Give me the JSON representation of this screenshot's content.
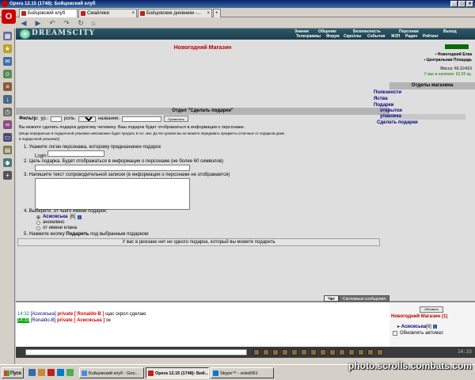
{
  "window": {
    "title": "Opera 12.15 (1748): Бойцовский клуб"
  },
  "browser_tabs": [
    {
      "label": "Бойцовский клуб"
    },
    {
      "label": "Смайлики"
    },
    {
      "label": "Бойцовские дневники -..."
    }
  ],
  "game_nav": {
    "logo_text": "DREAMSCITY",
    "row1": [
      "Знания",
      "Общение",
      "Безопасность",
      "Персонаж",
      "Выход"
    ],
    "row2": [
      "Телеграммы",
      "Форум",
      "Скрολлы",
      "События",
      "ЖЗП",
      "Радио",
      "Рейтинг"
    ]
  },
  "shop": {
    "title": "Новогодний Магазин",
    "section_title": "Отдел \"Сделать подарки\"",
    "filter": {
      "label": "Фильтр:",
      "level_label": "ур.:",
      "role_label": "роль:",
      "role_value": "любая",
      "name_label": "название:",
      "apply_label": "Применить"
    },
    "description": {
      "line1": "Вы можете сделать подарок дорогому человеку. Ваш подарок будет отображаться в информации о персонаже.",
      "line2": "(вещи переданные в подарочной упаковке невозможно будет продать в гос. маг. До 8го уровня вы не можете передавать предметы отличные от подарков даже",
      "line3": "в подарочной упаковке))"
    },
    "steps": {
      "s1": "1.  Укажите логин персонажа, которому предназначен подарок",
      "login_label": "Login",
      "s2": "2.  Цель подарка. Будет отображаться в информации о персонаже (не более 60 символов)",
      "s3": "3.  Напишите текст сопроводительной записки (в информации о персонаже не отображается)",
      "s4": "4.  Выберите, от чьего имени подарок:",
      "s5_prefix": "5.  Нажмите кнопку",
      "s5_bold": "Подарить",
      "s5_suffix": "под выбранным подарком:"
    },
    "from_options": [
      {
        "label": "Асисяська",
        "level": "[6]",
        "checked": true
      },
      {
        "label": "анонимно",
        "checked": false
      },
      {
        "label": "от имени клана",
        "checked": false
      }
    ],
    "empty_message": "У вас в рюкзаке нет ни одного подарка, который вы можете подарить"
  },
  "right_panel": {
    "location_line1": "Новогодний Елка",
    "location_line2": "Центральная Площадь",
    "mass": "Масса: 69.31/410",
    "cash": "У вас в наличии: 62.55 кр.",
    "departments_title": "Отделы магазина",
    "departments": [
      {
        "label": "Полезности",
        "indent": false,
        "selected": false
      },
      {
        "label": "Яства",
        "indent": false,
        "selected": false
      },
      {
        "label": "Подарки",
        "indent": false,
        "selected": false
      },
      {
        "label": "открытки",
        "indent": true,
        "selected": false
      },
      {
        "label": "упаковка",
        "indent": true,
        "selected": true
      },
      {
        "label": "Сделать подарки",
        "indent": false,
        "selected": false
      }
    ]
  },
  "chat": {
    "tabs": [
      "Чат",
      "Системные сообщения"
    ],
    "lines": [
      {
        "time": "14:32",
        "from": "[Асисяська]",
        "private": "private",
        "to": "[ Ronaldo-B ]",
        "text": "щас скрол сделаю",
        "hl": false
      },
      {
        "time": "14:33",
        "from": "[Ronaldo-B]",
        "private": "private",
        "to": "[ Асисяська ]",
        "text": "ок",
        "hl": true
      }
    ]
  },
  "online": {
    "refresh": "Обновить",
    "room": "Новогодний Магазин (1)",
    "user": "Асисяська",
    "user_level": "[6]",
    "auto_update": "Обновлять автомат."
  },
  "chat_input": {
    "clock": "14:33"
  },
  "taskbar": {
    "start": "Пуск",
    "tasks": [
      {
        "label": "Бойцовский клуб - Goo...",
        "active": false
      },
      {
        "label": "Opera 12.15 (1748): Бой...",
        "active": true
      },
      {
        "label": "Skype™ - sokol061",
        "active": false
      }
    ],
    "watermark": "photo.scrolls.combats.com"
  },
  "colors": {
    "header_bg": "#2d5a6a",
    "shop_title": "#bb0000",
    "link_blue": "#000080",
    "private_red": "#dd0000"
  }
}
